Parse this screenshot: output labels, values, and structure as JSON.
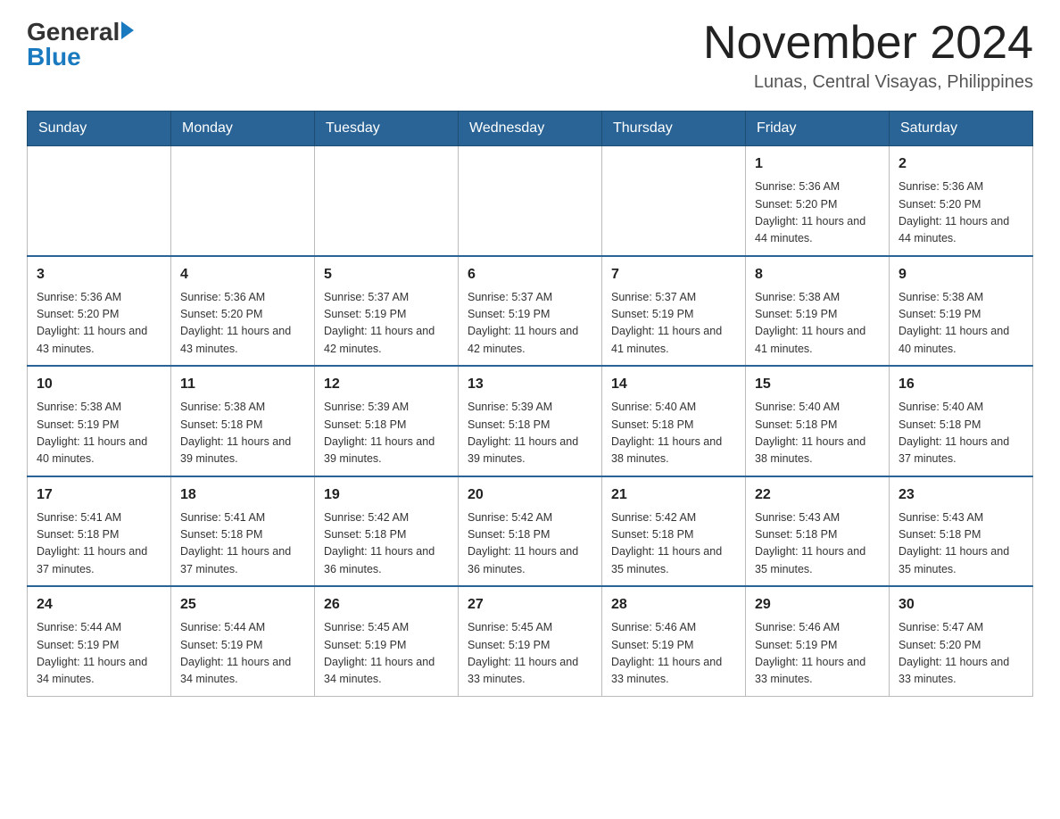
{
  "logo": {
    "general": "General",
    "blue": "Blue",
    "arrow_color": "#1a7abf"
  },
  "header": {
    "title": "November 2024",
    "location": "Lunas, Central Visayas, Philippines"
  },
  "days_of_week": [
    "Sunday",
    "Monday",
    "Tuesday",
    "Wednesday",
    "Thursday",
    "Friday",
    "Saturday"
  ],
  "weeks": [
    {
      "cells": [
        {
          "day": "",
          "info": ""
        },
        {
          "day": "",
          "info": ""
        },
        {
          "day": "",
          "info": ""
        },
        {
          "day": "",
          "info": ""
        },
        {
          "day": "",
          "info": ""
        },
        {
          "day": "1",
          "info": "Sunrise: 5:36 AM\nSunset: 5:20 PM\nDaylight: 11 hours and 44 minutes."
        },
        {
          "day": "2",
          "info": "Sunrise: 5:36 AM\nSunset: 5:20 PM\nDaylight: 11 hours and 44 minutes."
        }
      ]
    },
    {
      "cells": [
        {
          "day": "3",
          "info": "Sunrise: 5:36 AM\nSunset: 5:20 PM\nDaylight: 11 hours and 43 minutes."
        },
        {
          "day": "4",
          "info": "Sunrise: 5:36 AM\nSunset: 5:20 PM\nDaylight: 11 hours and 43 minutes."
        },
        {
          "day": "5",
          "info": "Sunrise: 5:37 AM\nSunset: 5:19 PM\nDaylight: 11 hours and 42 minutes."
        },
        {
          "day": "6",
          "info": "Sunrise: 5:37 AM\nSunset: 5:19 PM\nDaylight: 11 hours and 42 minutes."
        },
        {
          "day": "7",
          "info": "Sunrise: 5:37 AM\nSunset: 5:19 PM\nDaylight: 11 hours and 41 minutes."
        },
        {
          "day": "8",
          "info": "Sunrise: 5:38 AM\nSunset: 5:19 PM\nDaylight: 11 hours and 41 minutes."
        },
        {
          "day": "9",
          "info": "Sunrise: 5:38 AM\nSunset: 5:19 PM\nDaylight: 11 hours and 40 minutes."
        }
      ]
    },
    {
      "cells": [
        {
          "day": "10",
          "info": "Sunrise: 5:38 AM\nSunset: 5:19 PM\nDaylight: 11 hours and 40 minutes."
        },
        {
          "day": "11",
          "info": "Sunrise: 5:38 AM\nSunset: 5:18 PM\nDaylight: 11 hours and 39 minutes."
        },
        {
          "day": "12",
          "info": "Sunrise: 5:39 AM\nSunset: 5:18 PM\nDaylight: 11 hours and 39 minutes."
        },
        {
          "day": "13",
          "info": "Sunrise: 5:39 AM\nSunset: 5:18 PM\nDaylight: 11 hours and 39 minutes."
        },
        {
          "day": "14",
          "info": "Sunrise: 5:40 AM\nSunset: 5:18 PM\nDaylight: 11 hours and 38 minutes."
        },
        {
          "day": "15",
          "info": "Sunrise: 5:40 AM\nSunset: 5:18 PM\nDaylight: 11 hours and 38 minutes."
        },
        {
          "day": "16",
          "info": "Sunrise: 5:40 AM\nSunset: 5:18 PM\nDaylight: 11 hours and 37 minutes."
        }
      ]
    },
    {
      "cells": [
        {
          "day": "17",
          "info": "Sunrise: 5:41 AM\nSunset: 5:18 PM\nDaylight: 11 hours and 37 minutes."
        },
        {
          "day": "18",
          "info": "Sunrise: 5:41 AM\nSunset: 5:18 PM\nDaylight: 11 hours and 37 minutes."
        },
        {
          "day": "19",
          "info": "Sunrise: 5:42 AM\nSunset: 5:18 PM\nDaylight: 11 hours and 36 minutes."
        },
        {
          "day": "20",
          "info": "Sunrise: 5:42 AM\nSunset: 5:18 PM\nDaylight: 11 hours and 36 minutes."
        },
        {
          "day": "21",
          "info": "Sunrise: 5:42 AM\nSunset: 5:18 PM\nDaylight: 11 hours and 35 minutes."
        },
        {
          "day": "22",
          "info": "Sunrise: 5:43 AM\nSunset: 5:18 PM\nDaylight: 11 hours and 35 minutes."
        },
        {
          "day": "23",
          "info": "Sunrise: 5:43 AM\nSunset: 5:18 PM\nDaylight: 11 hours and 35 minutes."
        }
      ]
    },
    {
      "cells": [
        {
          "day": "24",
          "info": "Sunrise: 5:44 AM\nSunset: 5:19 PM\nDaylight: 11 hours and 34 minutes."
        },
        {
          "day": "25",
          "info": "Sunrise: 5:44 AM\nSunset: 5:19 PM\nDaylight: 11 hours and 34 minutes."
        },
        {
          "day": "26",
          "info": "Sunrise: 5:45 AM\nSunset: 5:19 PM\nDaylight: 11 hours and 34 minutes."
        },
        {
          "day": "27",
          "info": "Sunrise: 5:45 AM\nSunset: 5:19 PM\nDaylight: 11 hours and 33 minutes."
        },
        {
          "day": "28",
          "info": "Sunrise: 5:46 AM\nSunset: 5:19 PM\nDaylight: 11 hours and 33 minutes."
        },
        {
          "day": "29",
          "info": "Sunrise: 5:46 AM\nSunset: 5:19 PM\nDaylight: 11 hours and 33 minutes."
        },
        {
          "day": "30",
          "info": "Sunrise: 5:47 AM\nSunset: 5:20 PM\nDaylight: 11 hours and 33 minutes."
        }
      ]
    }
  ]
}
